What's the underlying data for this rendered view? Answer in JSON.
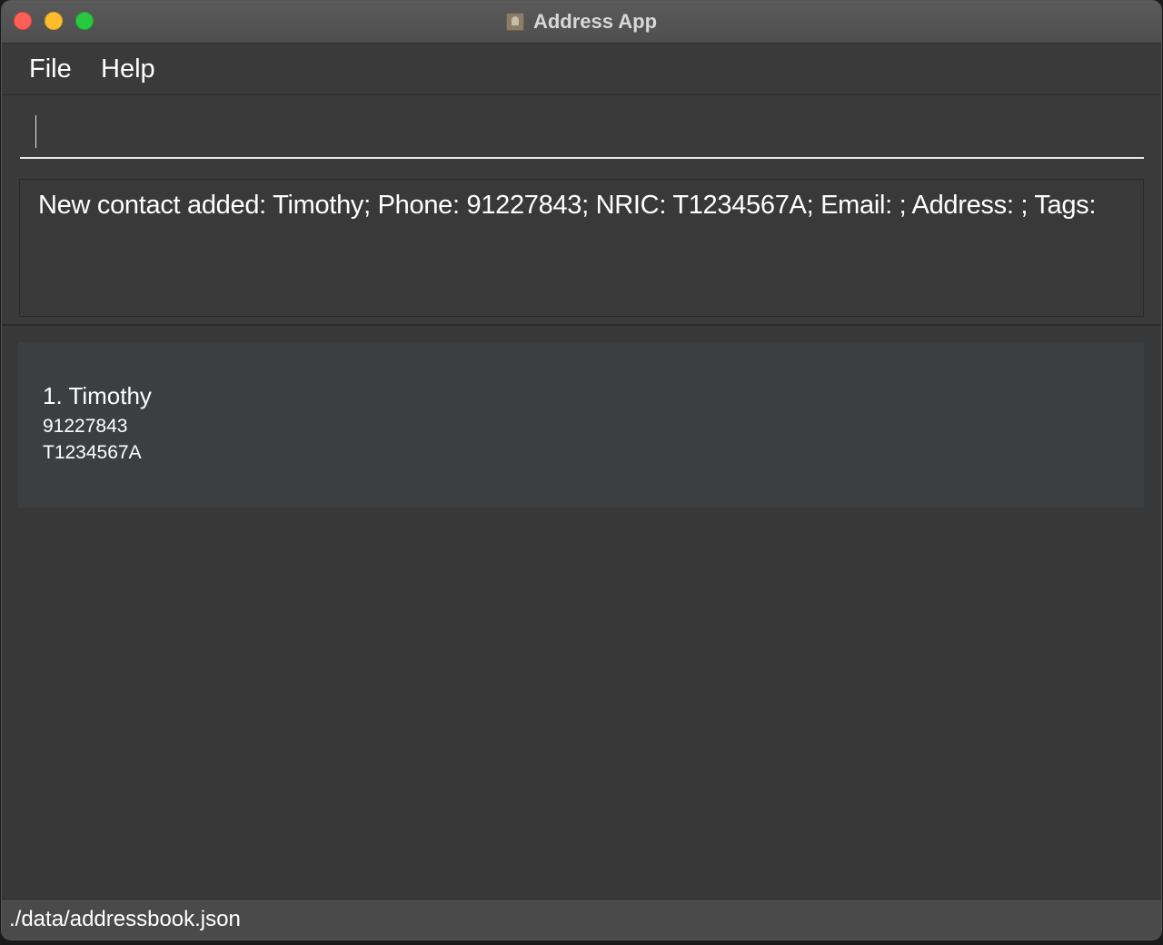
{
  "window": {
    "title": "Address App",
    "icon": "address-book-icon"
  },
  "menu": {
    "items": [
      {
        "label": "File"
      },
      {
        "label": "Help"
      }
    ]
  },
  "command": {
    "value": "",
    "placeholder": ""
  },
  "result": {
    "message": "New contact added: Timothy; Phone: 91227843; NRIC: T1234567A; Email: ; Address: ; Tags:"
  },
  "persons": [
    {
      "index_name": "1. Timothy",
      "phone": "91227843",
      "nric": "T1234567A"
    }
  ],
  "status": {
    "file_path": "./data/addressbook.json"
  },
  "colors": {
    "close": "#fe5f57",
    "minimize": "#febc2e",
    "maximize": "#28c840",
    "background": "#383838",
    "card": "#3c3f41"
  }
}
